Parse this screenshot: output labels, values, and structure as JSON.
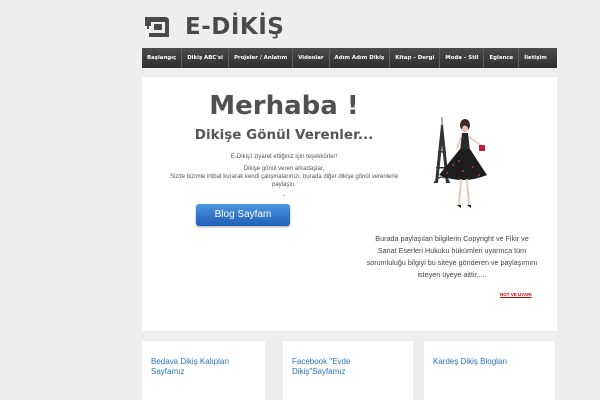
{
  "header": {
    "site_title": "E-DİKİŞ",
    "logo_icon": "sewing-machine-icon"
  },
  "nav": {
    "items": [
      "Başlangıç",
      "Dikiş ABC'si",
      "Projeler / Anlatım",
      "Videolar",
      "Adım Adım Dikiş",
      "Kitap – Dergi",
      "Moda – Stil",
      "Eglence",
      "İletişim"
    ]
  },
  "main": {
    "greeting": "Merhaba !",
    "subtitle": "Dikişe Gönül Verenler...",
    "thanks": "E-Dikiş'i ziyaret ettiğiniz için teşekkürler!",
    "paragraph1": "Dikişe gönül veren arkadaşlar,",
    "paragraph2": "Sizde bizimle irtibat kurarak kendi çalışmalarınızı, burada diğer dikişe gönül verenlerle paylaşın.",
    "separator": "-",
    "button_label": "Blog Sayfam",
    "copyright_text": "Burada paylaşılan bilgilerin Copyright ve Fikir ve Sanat Eserleri Hukuku hükümleri uyarınca tüm sorumluluğu bilgiyi bu siteye gönderen ve paylaşımını isteyen üyeye aittir.....",
    "notice_link": "NOT VE UYARI"
  },
  "cards": [
    {
      "title": "Bedava Dikiş Kalıpları Sayfamız"
    },
    {
      "title": "Facebook \"Evde Dikiş\"Sayfamız"
    },
    {
      "title": "Kardeş Dikiş Blogları"
    }
  ],
  "colors": {
    "nav_bg": "#3a3a3a",
    "button": "#2b6fc4",
    "link": "#2a74b8",
    "notice": "#cc0000"
  }
}
